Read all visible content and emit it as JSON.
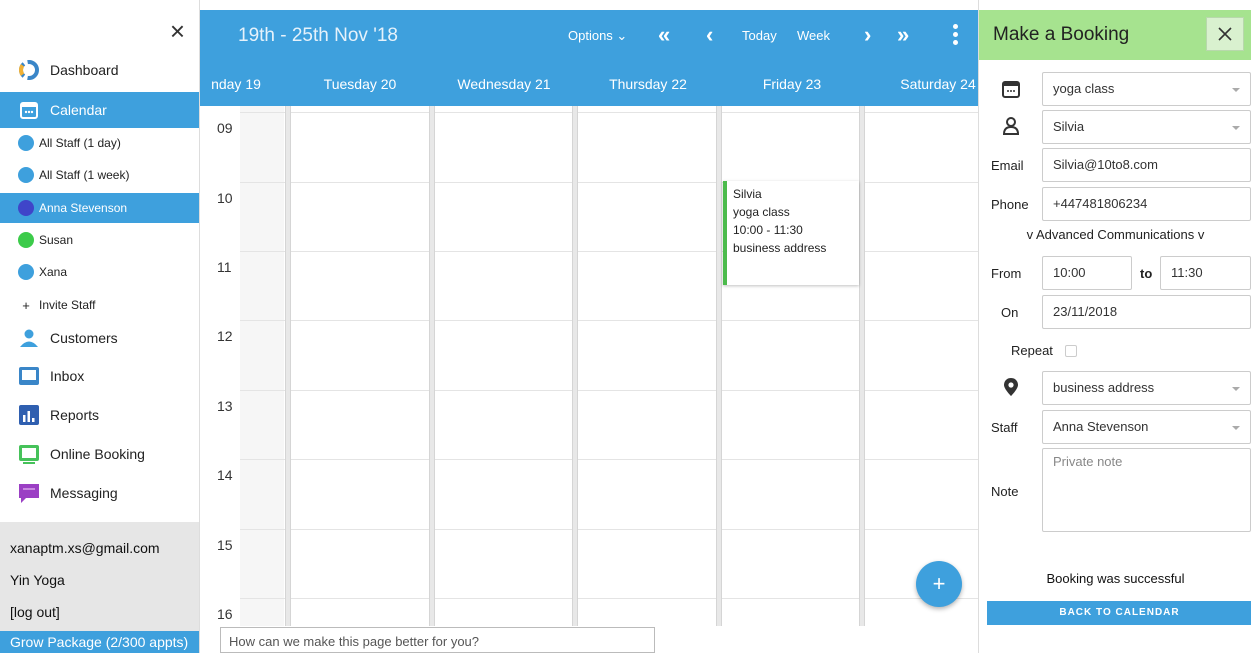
{
  "sidebar": {
    "close_glyph": "×",
    "nav": [
      {
        "label": "Dashboard",
        "icon": "dashboard-ring-icon"
      },
      {
        "label": "Calendar",
        "icon": "calendar-icon",
        "active": true
      }
    ],
    "staff": [
      {
        "label": "All Staff (1 day)",
        "color": "#3ea0dd"
      },
      {
        "label": "All Staff (1 week)",
        "color": "#3ea0dd"
      },
      {
        "label": "Anna Stevenson",
        "color": "#3f45c9",
        "active": true
      },
      {
        "label": "Susan",
        "color": "#3ccb4a"
      },
      {
        "label": "Xana",
        "color": "#3ea0dd"
      }
    ],
    "invite_label": "Invite Staff",
    "nav2": [
      {
        "label": "Customers",
        "icon": "customers-icon"
      },
      {
        "label": "Inbox",
        "icon": "inbox-icon"
      },
      {
        "label": "Reports",
        "icon": "reports-icon"
      },
      {
        "label": "Online Booking",
        "icon": "online-booking-icon"
      },
      {
        "label": "Messaging",
        "icon": "messaging-icon"
      }
    ],
    "account": {
      "email": "xanaptm.xs@gmail.com",
      "business": "Yin Yoga",
      "logout": "[log out]",
      "package": "Grow Package (2/300 appts)"
    }
  },
  "calendar": {
    "range": "19th - 25th Nov '18",
    "options_label": "Options ⌄",
    "today_label": "Today",
    "week_label": "Week",
    "days": [
      "nday 19",
      "Tuesday 20",
      "Wednesday 21",
      "Thursday 22",
      "Friday 23",
      "Saturday 24"
    ],
    "hours": [
      "09",
      "10",
      "11",
      "12",
      "13",
      "14",
      "15",
      "16"
    ],
    "event": {
      "name": "Silvia",
      "service": "yoga class",
      "time": "10:00 - 11:30",
      "location": "business address"
    },
    "fab_label": "+",
    "feedback_placeholder": "How can we make this page better for you?"
  },
  "booking": {
    "title": "Make a Booking",
    "service": "yoga class",
    "customer": "Silvia",
    "email_label": "Email",
    "email": "Silvia@10to8.com",
    "phone_label": "Phone",
    "phone": "+447481806234",
    "advanced_label": "v Advanced Communications v",
    "from_label": "From",
    "from": "10:00",
    "to_label": "to",
    "to": "11:30",
    "on_label": "On",
    "on": "23/11/2018",
    "repeat_label": "Repeat",
    "location": "business address",
    "staff_label": "Staff",
    "staff": "Anna Stevenson",
    "note_label": "Note",
    "note_placeholder": "Private note",
    "success": "Booking was successful",
    "back_label": "BACK TO CALENDAR"
  },
  "colors": {
    "primary": "#3ea0dd",
    "panel_header": "#a6e38f",
    "event_accent": "#4cbb4c"
  }
}
